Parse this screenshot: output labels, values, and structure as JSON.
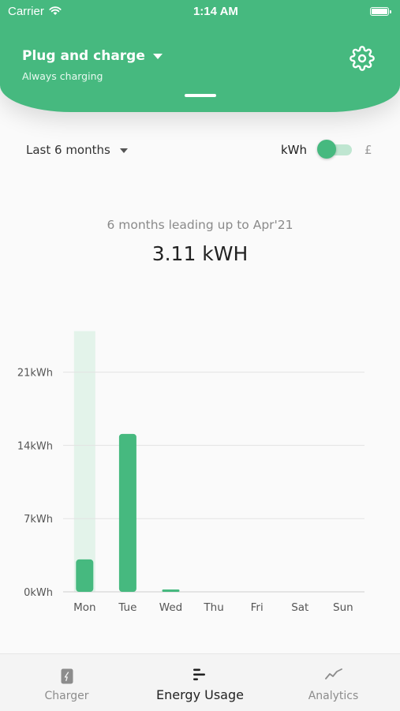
{
  "status_bar": {
    "carrier": "Carrier",
    "time": "1:14 AM"
  },
  "header": {
    "title": "Plug and charge",
    "subtitle": "Always charging"
  },
  "filters": {
    "period": "Last 6 months",
    "unit_left": "kWh",
    "unit_right": "£",
    "unit_toggle_on": false
  },
  "summary": {
    "caption": "6 months leading up to Apr'21",
    "total": "3.11 kWH"
  },
  "chart_data": {
    "type": "bar",
    "categories": [
      "Mon",
      "Tue",
      "Wed",
      "Thu",
      "Fri",
      "Sat",
      "Sun"
    ],
    "values": [
      3.1,
      15.1,
      0.2,
      0,
      0,
      0,
      0
    ],
    "yticks": [
      "0kWh",
      "7kWh",
      "14kWh",
      "21kWh"
    ],
    "ytick_values": [
      0,
      7,
      14,
      21
    ],
    "ylim": [
      0,
      25
    ],
    "highlight_category": "Mon",
    "grid": true,
    "bar_color": "#46b97f",
    "highlight_color": "#e3f3ea"
  },
  "nav": {
    "charger": {
      "label": "Charger",
      "icon": "phone-icon"
    },
    "energy": {
      "label": "Energy Usage",
      "icon": "bars-icon"
    },
    "analytics": {
      "label": "Analytics",
      "icon": "trend-line-icon"
    }
  },
  "colors": {
    "accent": "#46b97f",
    "background": "#fafafa"
  }
}
